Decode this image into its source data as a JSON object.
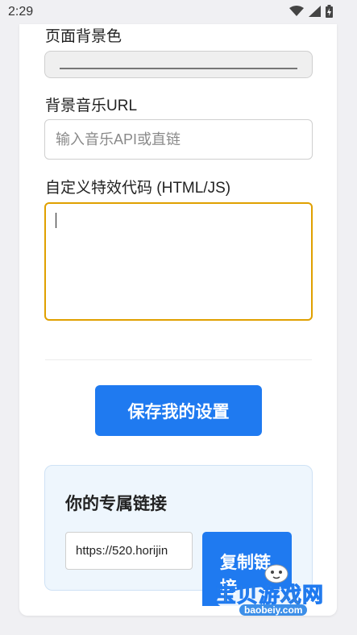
{
  "status_bar": {
    "time": "2:29",
    "icons": [
      "wifi-icon",
      "signal-icon",
      "battery-icon"
    ]
  },
  "form": {
    "bg_color_label": "页面背景色",
    "music_label": "背景音乐URL",
    "music_placeholder": "输入音乐API或直链",
    "music_value": "",
    "effects_label": "自定义特效代码 (HTML/JS)",
    "effects_value": "",
    "save_button": "保存我的设置"
  },
  "link_section": {
    "title": "你的专属链接",
    "link_value": "https://520.horijin",
    "copy_button": "复制链接"
  },
  "watermark": {
    "text": "宝贝游戏网",
    "url": "baobeiy.com"
  },
  "colors": {
    "primary": "#1f7af0",
    "focus_border": "#e0a000",
    "link_box_bg": "#eef6fd"
  }
}
